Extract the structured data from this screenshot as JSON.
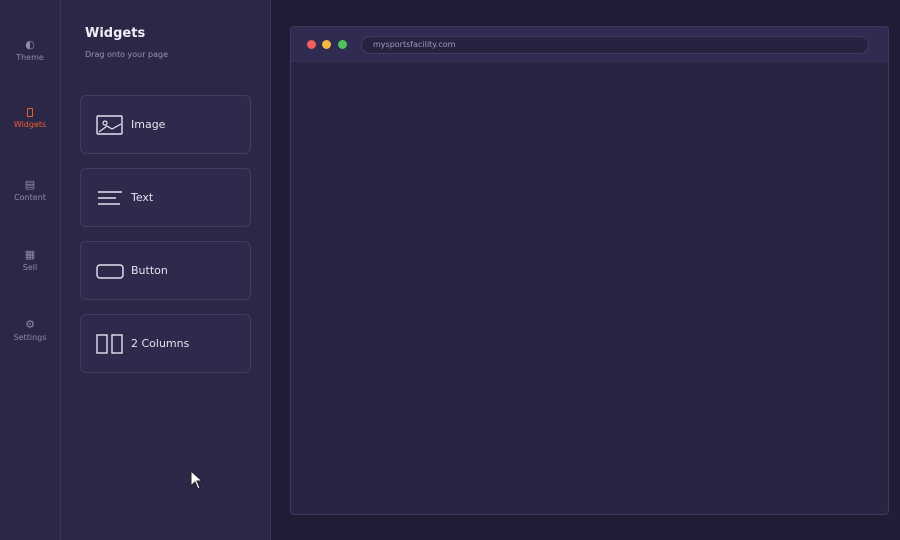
{
  "rail": {
    "items": [
      {
        "label": "Theme",
        "icon": "◐"
      },
      {
        "label": "Widgets",
        "icon": ""
      },
      {
        "label": "Content",
        "icon": "▤"
      },
      {
        "label": "Sell",
        "icon": "▦"
      },
      {
        "label": "Settings",
        "icon": "⚙"
      }
    ],
    "active": "Widgets",
    "accent_color": "#f25c2a"
  },
  "panel": {
    "title": "Widgets",
    "subtitle": "Drag onto your page",
    "widgets": [
      {
        "label": "Image",
        "icon": "image-icon"
      },
      {
        "label": "Text",
        "icon": "text-icon"
      },
      {
        "label": "Button",
        "icon": "button-icon"
      },
      {
        "label": "2 Columns",
        "icon": "columns-icon"
      }
    ]
  },
  "browser": {
    "url": "mysportsfacility.com"
  }
}
